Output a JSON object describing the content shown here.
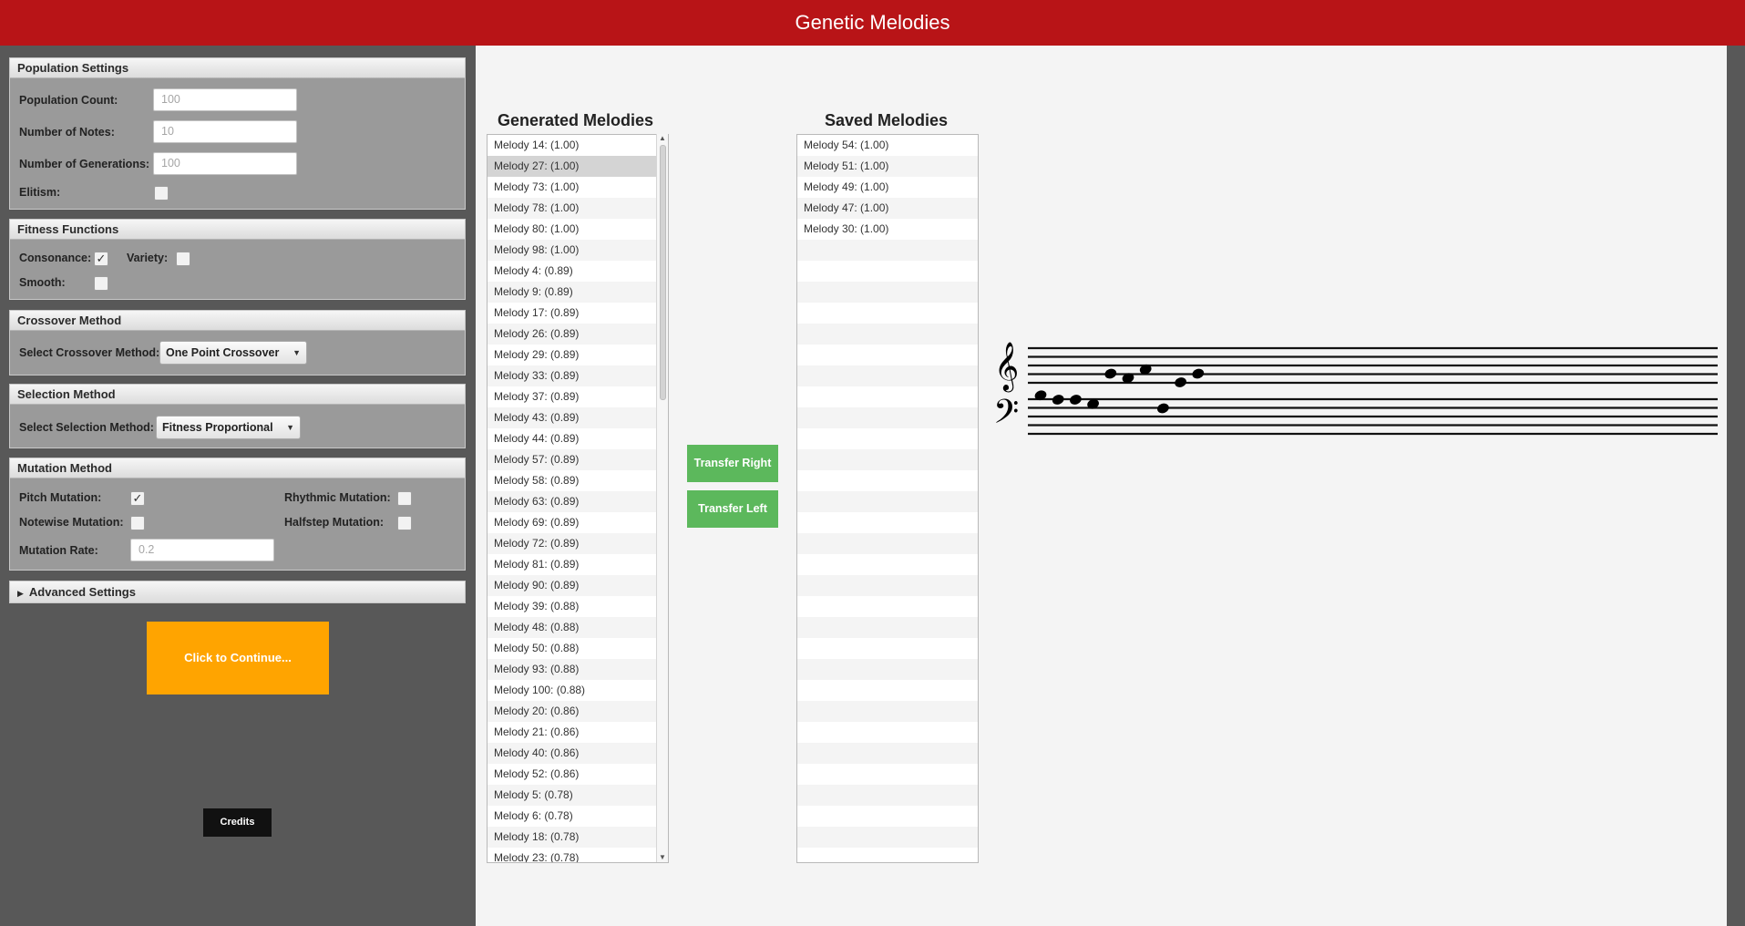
{
  "app": {
    "title": "Genetic Melodies"
  },
  "population": {
    "header": "Population Settings",
    "count_label": "Population Count:",
    "count_value": "100",
    "notes_label": "Number of Notes:",
    "notes_value": "10",
    "generations_label": "Number of Generations:",
    "generations_value": "100",
    "elitism_label": "Elitism:",
    "elitism_checked": false
  },
  "fitness": {
    "header": "Fitness Functions",
    "consonance_label": "Consonance:",
    "consonance_checked": true,
    "variety_label": "Variety:",
    "variety_checked": false,
    "smooth_label": "Smooth:",
    "smooth_checked": false
  },
  "crossover": {
    "header": "Crossover Method",
    "select_label": "Select Crossover Method:",
    "selected": "One Point Crossover"
  },
  "selection": {
    "header": "Selection Method",
    "select_label": "Select Selection Method:",
    "selected": "Fitness Proportional"
  },
  "mutation": {
    "header": "Mutation Method",
    "pitch_label": "Pitch Mutation:",
    "pitch_checked": true,
    "rhythmic_label": "Rhythmic Mutation:",
    "rhythmic_checked": false,
    "notewise_label": "Notewise Mutation:",
    "notewise_checked": false,
    "halfstep_label": "Halfstep Mutation:",
    "halfstep_checked": false,
    "rate_label": "Mutation Rate:",
    "rate_value": "0.2"
  },
  "advanced": {
    "label": "Advanced Settings"
  },
  "actions": {
    "continue_label": "Click to Continue...",
    "credits_label": "Credits"
  },
  "generated": {
    "heading": "Generated Melodies",
    "items": [
      "Melody 14: (1.00)",
      "Melody 27: (1.00)",
      "Melody 73: (1.00)",
      "Melody 78: (1.00)",
      "Melody 80: (1.00)",
      "Melody 98: (1.00)",
      "Melody 4: (0.89)",
      "Melody 9: (0.89)",
      "Melody 17: (0.89)",
      "Melody 26: (0.89)",
      "Melody 29: (0.89)",
      "Melody 33: (0.89)",
      "Melody 37: (0.89)",
      "Melody 43: (0.89)",
      "Melody 44: (0.89)",
      "Melody 57: (0.89)",
      "Melody 58: (0.89)",
      "Melody 63: (0.89)",
      "Melody 69: (0.89)",
      "Melody 72: (0.89)",
      "Melody 81: (0.89)",
      "Melody 90: (0.89)",
      "Melody 39: (0.88)",
      "Melody 48: (0.88)",
      "Melody 50: (0.88)",
      "Melody 93: (0.88)",
      "Melody 100: (0.88)",
      "Melody 20: (0.86)",
      "Melody 21: (0.86)",
      "Melody 40: (0.86)",
      "Melody 52: (0.86)",
      "Melody 5: (0.78)",
      "Melody 6: (0.78)",
      "Melody 18: (0.78)",
      "Melody 23: (0.78)"
    ],
    "selected_index": 1
  },
  "transfer": {
    "right_label": "Transfer Right",
    "left_label": "Transfer Left"
  },
  "saved": {
    "heading": "Saved Melodies",
    "items": [
      "Melody 54: (1.00)",
      "Melody 51: (1.00)",
      "Melody 49: (1.00)",
      "Melody 47: (1.00)",
      "Melody 30: (1.00)"
    ],
    "blank_rows": 30
  },
  "score": {
    "treble_clef": "𝄞",
    "bass_clef": "𝄢",
    "notes_offset_from_middle_c": [
      -1,
      -2,
      -2,
      -3,
      4,
      3,
      5,
      -4,
      2,
      4
    ]
  }
}
